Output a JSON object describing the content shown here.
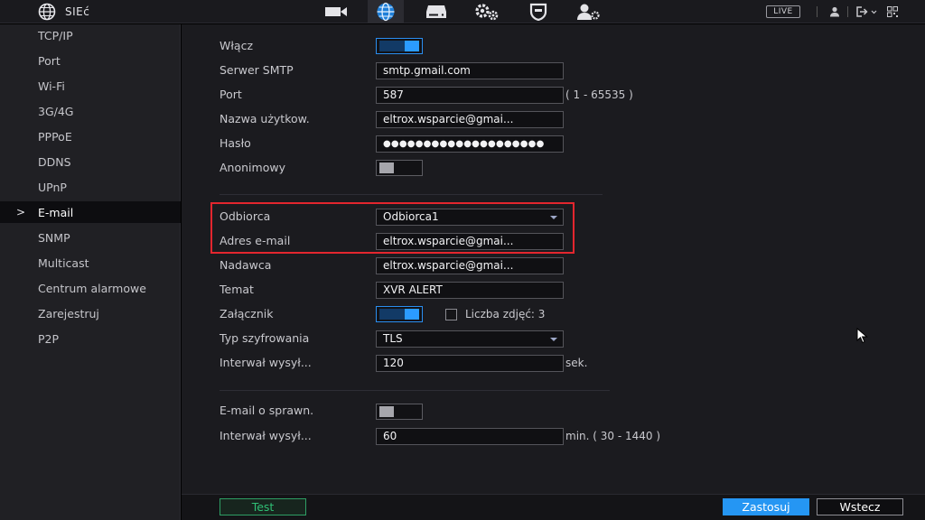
{
  "topbar": {
    "title": "SIEć",
    "live_label": "LIVE",
    "icons": [
      "camera-icon",
      "network-globe-icon",
      "storage-icon",
      "settings-gears-icon",
      "shield-icon",
      "user-management-icon"
    ],
    "right_icons": [
      "user-icon",
      "logout-icon",
      "qr-code-icon"
    ]
  },
  "sidebar": {
    "items": [
      {
        "label": "TCP/IP"
      },
      {
        "label": "Port"
      },
      {
        "label": "Wi-Fi"
      },
      {
        "label": "3G/4G"
      },
      {
        "label": "PPPoE"
      },
      {
        "label": "DDNS"
      },
      {
        "label": "UPnP"
      },
      {
        "label": "E-mail",
        "active": true
      },
      {
        "label": "SNMP"
      },
      {
        "label": "Multicast"
      },
      {
        "label": "Centrum alarmowe"
      },
      {
        "label": "Zarejestruj"
      },
      {
        "label": "P2P"
      }
    ]
  },
  "form": {
    "enable": {
      "label": "Włącz",
      "on": true
    },
    "smtp_server": {
      "label": "Serwer SMTP",
      "value": "smtp.gmail.com"
    },
    "port": {
      "label": "Port",
      "value": "587",
      "range": "( 1 - 65535 )"
    },
    "username": {
      "label": "Nazwa użytkow.",
      "value": "eltrox.wsparcie@gmai..."
    },
    "password": {
      "label": "Hasło",
      "value": "●●●●●●●●●●●●●●●●●●●●"
    },
    "anonymous": {
      "label": "Anonimowy",
      "on": false
    },
    "recipient": {
      "label": "Odbiorca",
      "value": "Odbiorca1"
    },
    "email_address": {
      "label": "Adres e-mail",
      "value": "eltrox.wsparcie@gmai..."
    },
    "sender": {
      "label": "Nadawca",
      "value": "eltrox.wsparcie@gmai..."
    },
    "subject": {
      "label": "Temat",
      "value": "XVR ALERT"
    },
    "attachment": {
      "label": "Załącznik",
      "on": true,
      "photo_count_label": "Liczba zdjęć: 3",
      "photo_count_checked": false
    },
    "encryption": {
      "label": "Typ szyfrowania",
      "value": "TLS"
    },
    "send_interval": {
      "label": "Interwał wysył...",
      "value": "120",
      "unit": "sek."
    },
    "health_email": {
      "label": "E-mail o sprawn.",
      "on": false
    },
    "health_interval": {
      "label": "Interwał wysył...",
      "value": "60",
      "unit": "min.  ( 30 - 1440 )"
    }
  },
  "buttons": {
    "test": "Test",
    "apply": "Zastosuj",
    "back": "Wstecz"
  }
}
